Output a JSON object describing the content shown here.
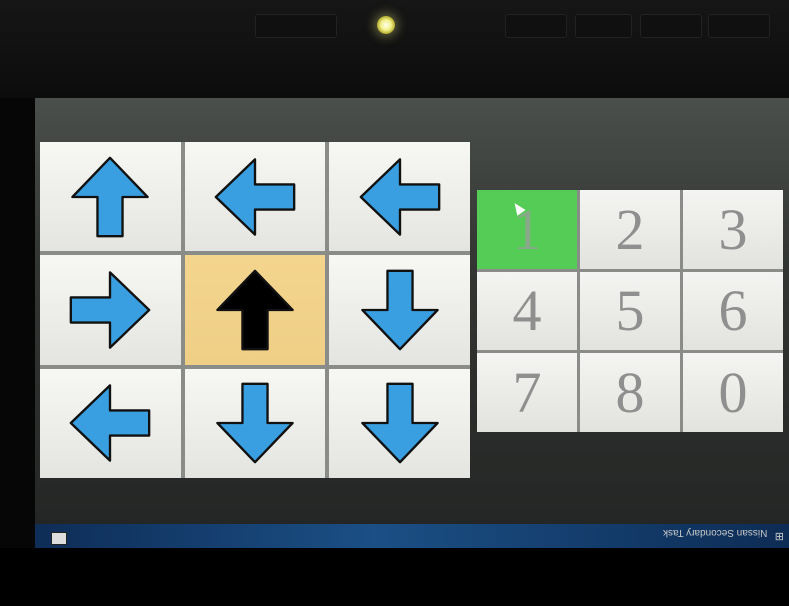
{
  "colors": {
    "arrow_fill": "#3a9fe0",
    "arrow_highlight_fill": "#000000",
    "highlight_cell": "#f4d58e",
    "active_key": "#55cc55"
  },
  "arrow_grid": {
    "cells": [
      {
        "direction": "up",
        "highlighted": false
      },
      {
        "direction": "left",
        "highlighted": false
      },
      {
        "direction": "left",
        "highlighted": false
      },
      {
        "direction": "right",
        "highlighted": false
      },
      {
        "direction": "up",
        "highlighted": true
      },
      {
        "direction": "down",
        "highlighted": false
      },
      {
        "direction": "left",
        "highlighted": false
      },
      {
        "direction": "down",
        "highlighted": false
      },
      {
        "direction": "down",
        "highlighted": false
      }
    ]
  },
  "num_pad": {
    "keys": [
      {
        "label": "1",
        "active": true
      },
      {
        "label": "2",
        "active": false
      },
      {
        "label": "3",
        "active": false
      },
      {
        "label": "4",
        "active": false
      },
      {
        "label": "5",
        "active": false
      },
      {
        "label": "6",
        "active": false
      },
      {
        "label": "7",
        "active": false
      },
      {
        "label": "8",
        "active": false
      },
      {
        "label": "0",
        "active": false
      }
    ]
  },
  "taskbar": {
    "label": "Nissan Secondary Task",
    "icon": "windows-logo-icon"
  }
}
